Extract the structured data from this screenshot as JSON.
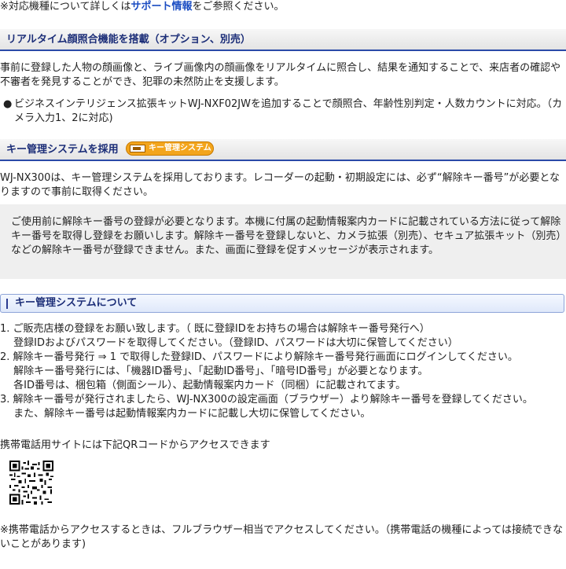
{
  "top_note": {
    "prefix": "※対応機種について詳しくは",
    "link": "サポート情報",
    "suffix": "をご参照ください。"
  },
  "section1": {
    "title": "リアルタイム顔照合機能を搭載（オプション、別売）",
    "paragraph": "事前に登録した人物の顔画像と、ライブ画像内の顔画像をリアルタイムに照合し、結果を通知することで、来店者の確認や不審者を発見することができ、犯罪の未然防止を支援します。",
    "bullet": "ビジネスインテリジェンス拡張キットWJ-NXF02JWを追加することで顔照合、年齢性別判定・人数カウントに対応。（カメラ入力1、2に対応)"
  },
  "section2": {
    "title": "キー管理システムを採用",
    "badge_label": "キー管理システム",
    "paragraph": "WJ-NX300は、キー管理システムを採用しております。レコーダーの起動・初期設定には、必ず“解除キー番号”が必要となりますので事前に取得ください。",
    "notice": "ご使用前に解除キー番号の登録が必要となります。本機に付属の起動情報案内カードに記載されている方法に従って解除キー番号を取得し登録をお願いします。解除キー番号を登録しないと、カメラ拡張（別売）、セキュア拡張キット（別売）などの解除キー番号が登録できません。また、画面に登録を促すメッセージが表示されます。"
  },
  "about": {
    "title": "キー管理システムについて",
    "lines": [
      "1. ご販売店様の登録をお願い致します。（ 既に登録IDをお持ちの場合は解除キー番号発行へ）",
      "　 登録IDおよびパスワードを取得してください。（登録ID、パスワードは大切に保管してください）",
      "2. 解除キー番号発行 ⇒ 1 で取得した登録ID、パスワードにより解除キー番号発行画面にログインしてください。",
      "　 解除キー番号発行には、「機器ID番号」、「起動ID番号」、「暗号ID番号」が必要となります。",
      "　 各ID番号は、梱包箱（側面シール）、起動情報案内カード（同梱）に記載されてます。",
      "3. 解除キー番号が発行されましたら、WJ-NX300の設定画面（ブラウザー）より解除キー番号を登録してください。",
      "　 また、解除キー番号は起動情報案内カードに記載し大切に保管してください。"
    ]
  },
  "mobile": {
    "text": "携帯電話用サイトには下記QRコードからアクセスできます",
    "qr_icon": "qr-code-icon",
    "note": "※携帯電話からアクセスするときは、フルブラウザー相当でアクセスしてください。（携帯電話の機種によっては接続できないことがあります)"
  },
  "colors": {
    "link": "#1a4cc2",
    "heading": "#1c2e78",
    "rule": "#2a4aa8",
    "badge": "#f3a51c"
  }
}
